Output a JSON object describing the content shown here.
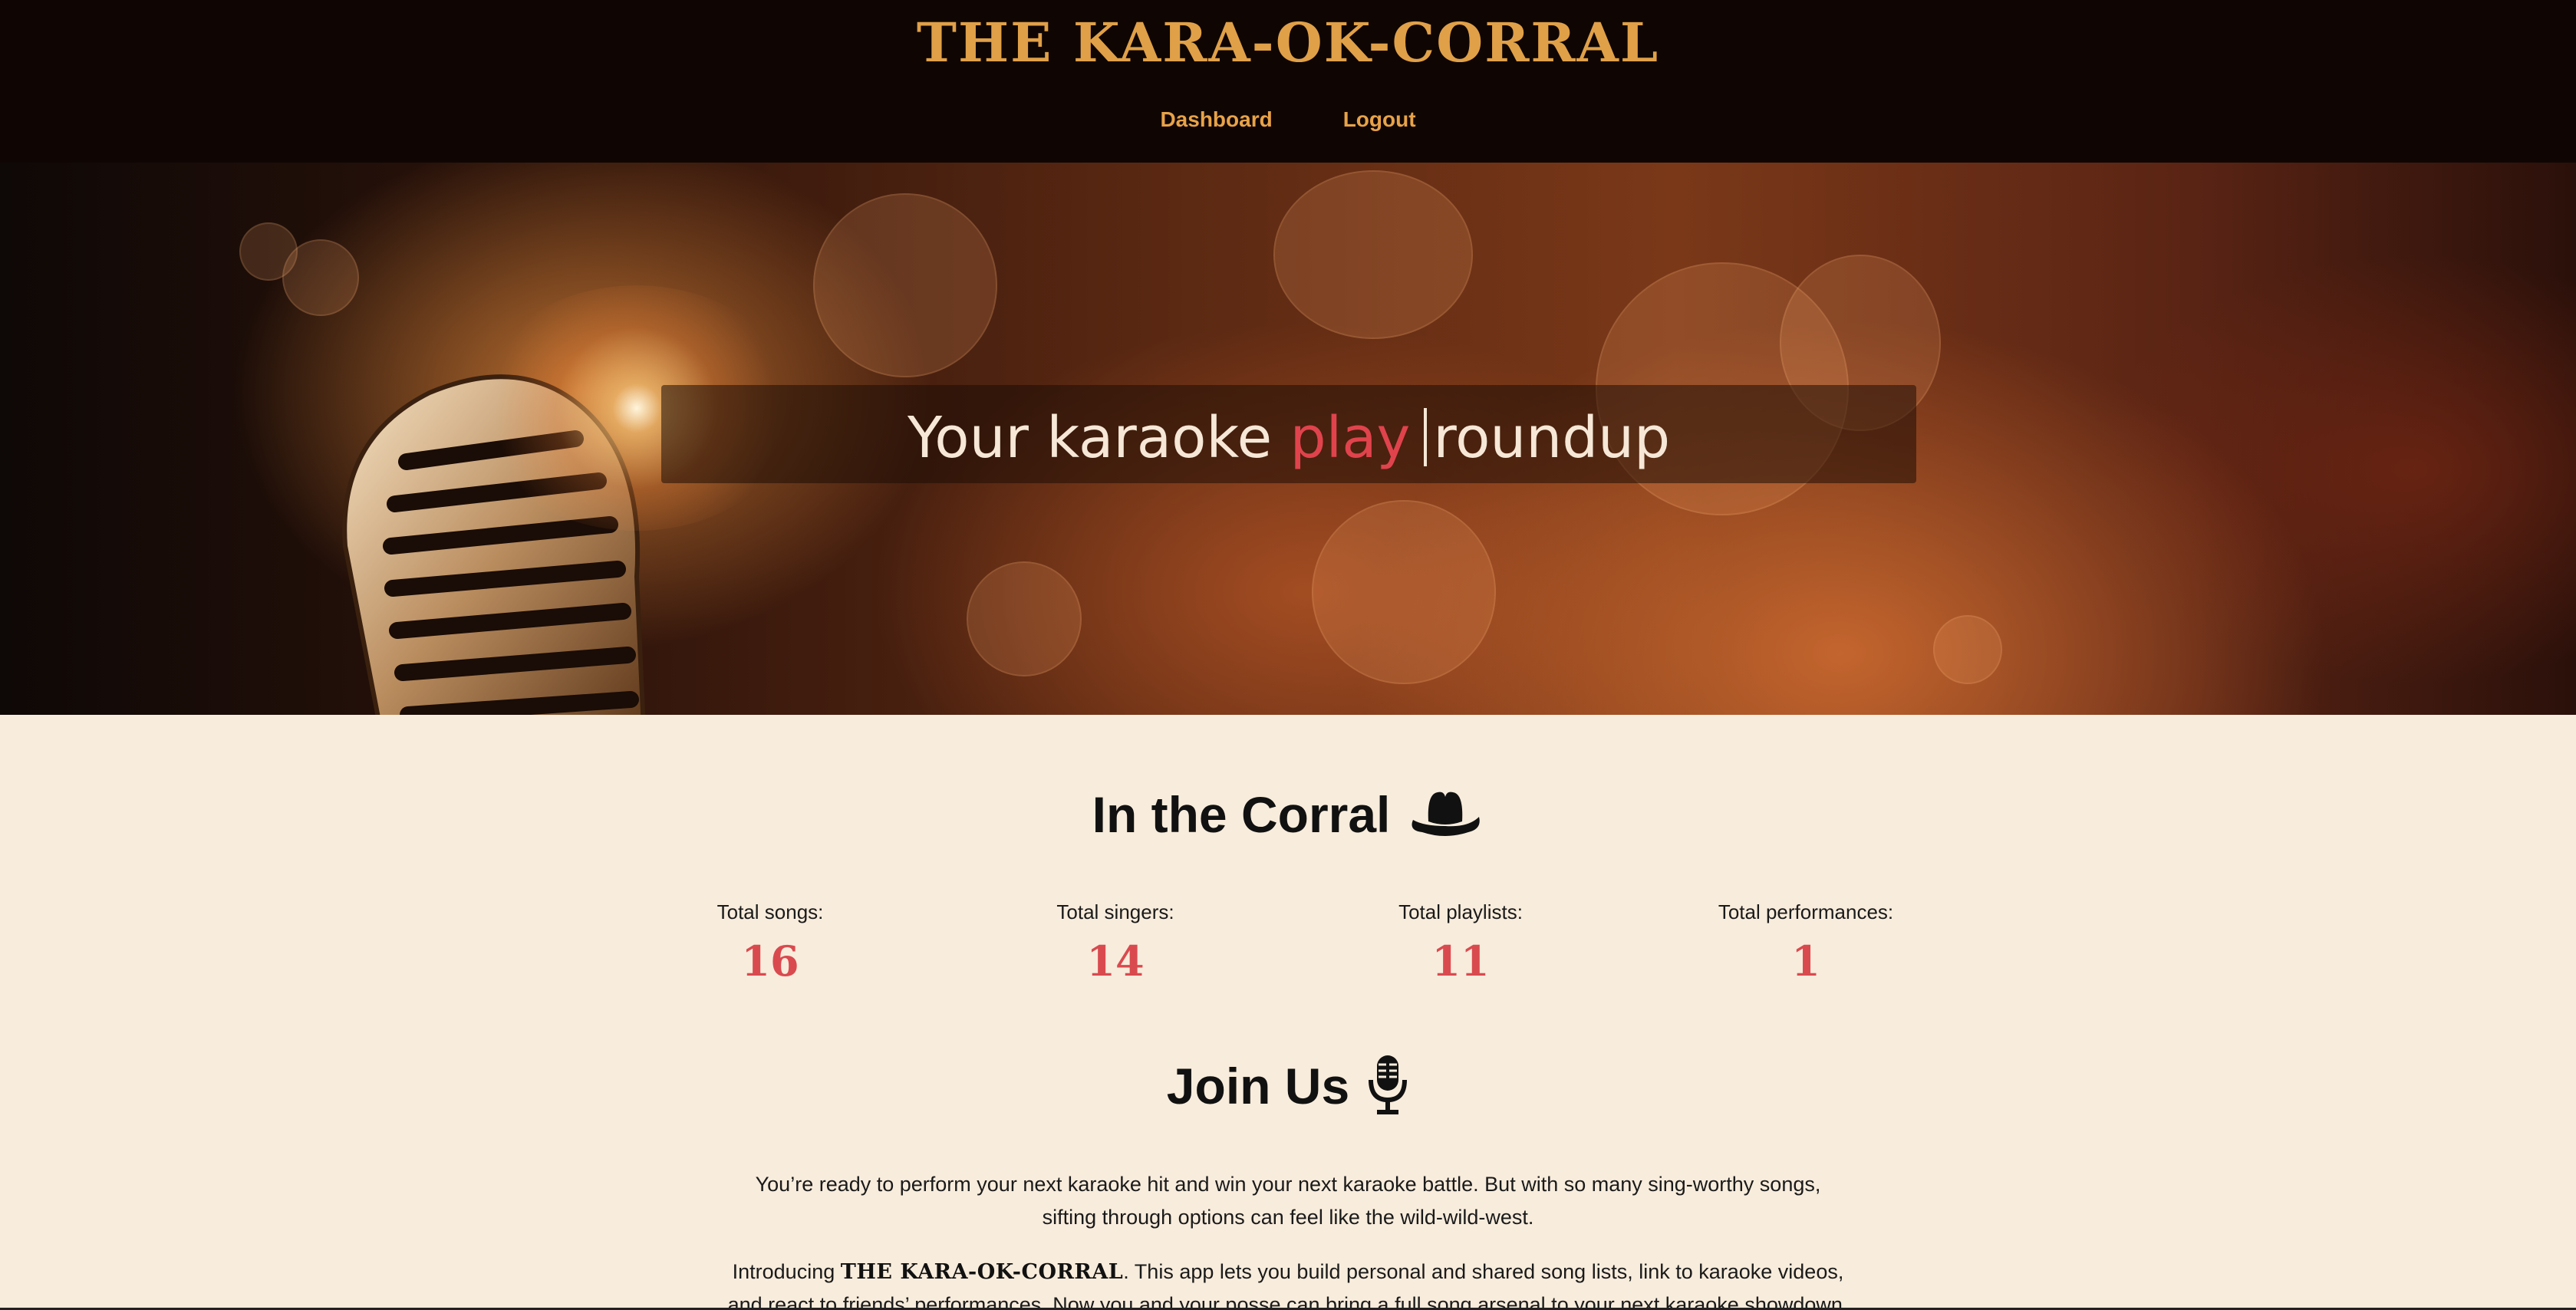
{
  "header": {
    "brand": "THE KARA-OK-CORRAL",
    "nav": [
      {
        "label": "Dashboard"
      },
      {
        "label": "Logout"
      }
    ]
  },
  "hero": {
    "tagline_prefix": "Your karaoke",
    "tagline_highlight": "play",
    "tagline_suffix": "roundup"
  },
  "corral": {
    "title": "In the Corral",
    "icon": "cowboy-hat-icon",
    "stats": [
      {
        "label": "Total songs:",
        "value": "16"
      },
      {
        "label": "Total singers:",
        "value": "14"
      },
      {
        "label": "Total playlists:",
        "value": "11"
      },
      {
        "label": "Total performances:",
        "value": "1"
      }
    ]
  },
  "join": {
    "title": "Join Us",
    "icon": "microphone-icon",
    "para1_line1": "You’re ready to perform your next karaoke hit and win your next karaoke battle. But with so many sing-worthy songs,",
    "para1_line2": "sifting through options can feel like the wild-wild-west.",
    "para2_intro": "Introducing",
    "para2_brand": "THE KARA-OK-CORRAL",
    "para2_line1_rest": ". This app lets you build personal and shared song lists, link to karaoke videos,",
    "para2_line2": "and react to friends’ performances. Now you and your posse can bring a full song arsenal to your next karaoke showdown."
  },
  "colors": {
    "accent": "#e0a048",
    "highlight": "#e0434c",
    "stat_value": "#d94a4f",
    "page_bg": "#f8ecdc",
    "header_bg": "#0f0604"
  }
}
